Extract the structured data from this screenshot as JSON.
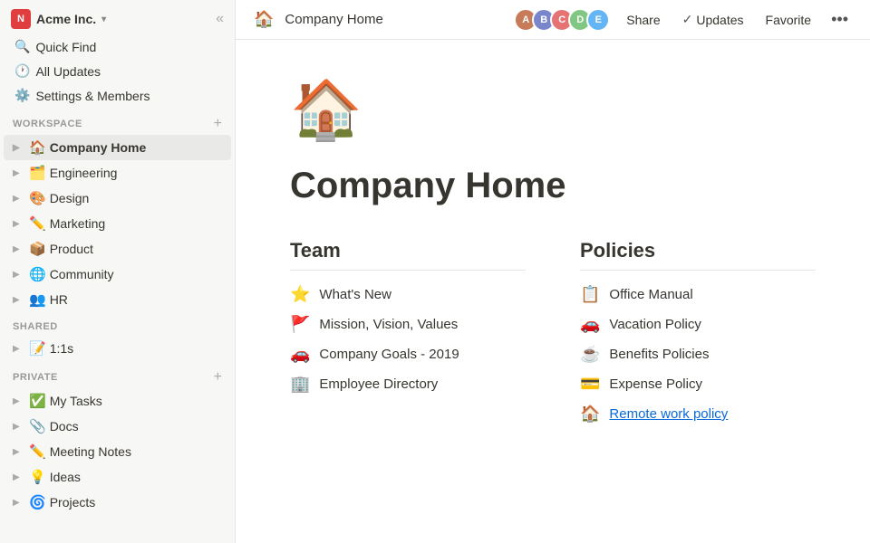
{
  "app": {
    "workspace_logo": "N",
    "workspace_name": "Acme Inc.",
    "collapse_icon": "«"
  },
  "sidebar": {
    "nav_items": [
      {
        "id": "quick-find",
        "icon": "🔍",
        "label": "Quick Find"
      },
      {
        "id": "all-updates",
        "icon": "🕐",
        "label": "All Updates"
      },
      {
        "id": "settings",
        "icon": "⚙️",
        "label": "Settings & Members"
      }
    ],
    "workspace_section": "WORKSPACE",
    "workspace_items": [
      {
        "id": "company-home",
        "icon": "🏠",
        "label": "Company Home",
        "active": true
      },
      {
        "id": "engineering",
        "icon": "🗂️",
        "label": "Engineering"
      },
      {
        "id": "design",
        "icon": "🎨",
        "label": "Design"
      },
      {
        "id": "marketing",
        "icon": "✏️",
        "label": "Marketing"
      },
      {
        "id": "product",
        "icon": "📦",
        "label": "Product"
      },
      {
        "id": "community",
        "icon": "🌐",
        "label": "Community"
      },
      {
        "id": "hr",
        "icon": "👥",
        "label": "HR"
      }
    ],
    "shared_section": "SHARED",
    "shared_items": [
      {
        "id": "1on1s",
        "icon": "📝",
        "label": "1:1s"
      }
    ],
    "private_section": "PRIVATE",
    "private_items": [
      {
        "id": "my-tasks",
        "icon": "✅",
        "label": "My Tasks"
      },
      {
        "id": "docs",
        "icon": "📎",
        "label": "Docs"
      },
      {
        "id": "meeting-notes",
        "icon": "✏️",
        "label": "Meeting Notes"
      },
      {
        "id": "ideas",
        "icon": "💡",
        "label": "Ideas"
      },
      {
        "id": "projects",
        "icon": "🌀",
        "label": "Projects"
      }
    ]
  },
  "header": {
    "page_icon": "🏠",
    "page_title": "Company Home",
    "share_label": "Share",
    "updates_label": "Updates",
    "favorite_label": "Favorite",
    "more_label": "•••",
    "avatars": [
      {
        "color": "#c77b58",
        "letter": "A"
      },
      {
        "color": "#7986cb",
        "letter": "B"
      },
      {
        "color": "#e57373",
        "letter": "C"
      },
      {
        "color": "#81c784",
        "letter": "D"
      },
      {
        "color": "#64b5f6",
        "letter": "E"
      }
    ]
  },
  "page": {
    "cover_icon": "🏠",
    "title": "Company Home",
    "columns": [
      {
        "id": "team",
        "heading": "Team",
        "items": [
          {
            "icon": "⭐",
            "label": "What's New",
            "link": false
          },
          {
            "icon": "🚩",
            "label": "Mission, Vision, Values",
            "link": false
          },
          {
            "icon": "🚗",
            "label": "Company Goals - 2019",
            "link": false
          },
          {
            "icon": "🏢",
            "label": "Employee Directory",
            "link": false
          }
        ]
      },
      {
        "id": "policies",
        "heading": "Policies",
        "items": [
          {
            "icon": "📋",
            "label": "Office Manual",
            "link": false
          },
          {
            "icon": "🚗",
            "label": "Vacation Policy",
            "link": false
          },
          {
            "icon": "☕",
            "label": "Benefits Policies",
            "link": false
          },
          {
            "icon": "💳",
            "label": "Expense Policy",
            "link": false
          },
          {
            "icon": "🏠",
            "label": "Remote work policy",
            "link": true
          }
        ]
      }
    ]
  }
}
